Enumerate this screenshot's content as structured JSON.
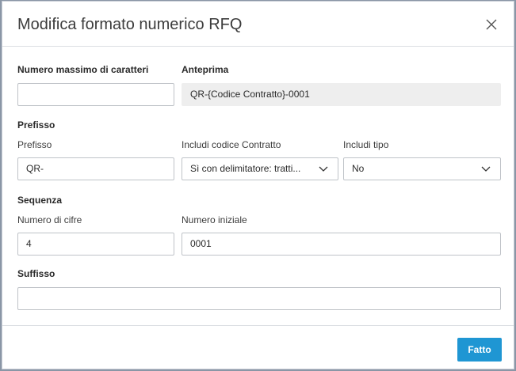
{
  "dialog": {
    "title": "Modifica formato numerico RFQ",
    "done_label": "Fatto"
  },
  "max_chars": {
    "label": "Numero massimo di caratteri",
    "value": ""
  },
  "preview": {
    "label": "Anteprima",
    "value": "QR-{Codice Contratto}-0001"
  },
  "prefix": {
    "section": "Prefisso",
    "prefix_label": "Prefisso",
    "prefix_value": "QR-",
    "contract_label": "Includi codice Contratto",
    "contract_value": "Sì con delimitatore: tratti...",
    "type_label": "Includi tipo",
    "type_value": "No"
  },
  "sequence": {
    "section": "Sequenza",
    "digits_label": "Numero di cifre",
    "digits_value": "4",
    "start_label": "Numero iniziale",
    "start_value": "0001"
  },
  "suffix": {
    "section": "Suffisso",
    "value": ""
  }
}
